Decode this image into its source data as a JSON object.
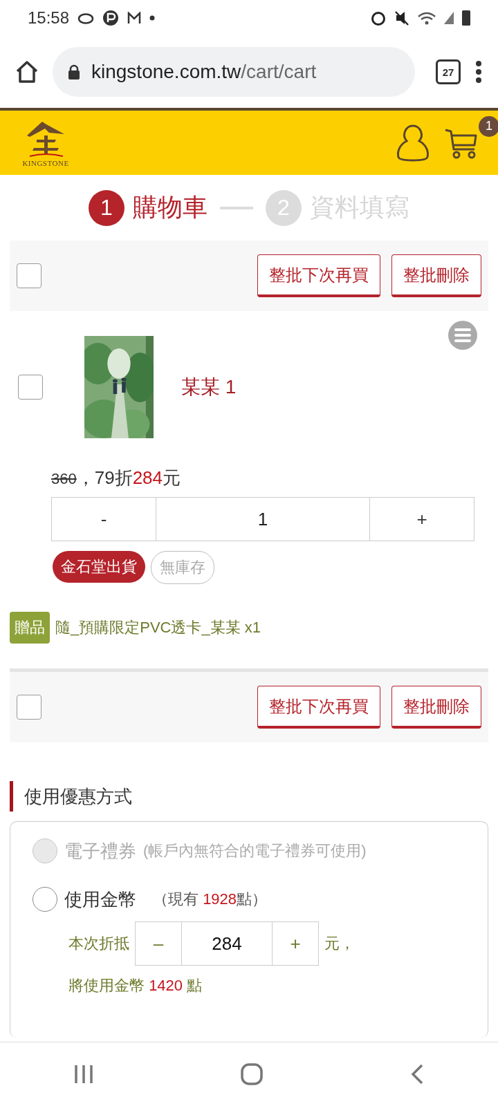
{
  "status_bar": {
    "time": "15:58"
  },
  "browser": {
    "url_host": "kingstone.com.tw",
    "url_path": "/cart/cart",
    "tab_count": "27"
  },
  "header": {
    "logo_text": "KINGSTONE",
    "cart_count": "1"
  },
  "steps": [
    {
      "number": "1",
      "label": "購物車",
      "selected": true
    },
    {
      "number": "2",
      "label": "資料填寫",
      "selected": false
    }
  ],
  "toolbars": [
    {
      "checked": false,
      "buttons": [
        "整批下次再買",
        "整批刪除"
      ]
    },
    {
      "checked": false,
      "buttons": [
        "整批下次再買",
        "整批刪除"
      ]
    }
  ],
  "item": {
    "checked": false,
    "title": "某某 1",
    "list_price": "360",
    "discount": "，79折",
    "price": "284",
    "unit": "元",
    "quantity": "1",
    "minus": "-",
    "plus": "+",
    "tags": [
      {
        "label": "金石堂出貨",
        "kind": "filled"
      },
      {
        "label": "無庫存",
        "kind": "outline"
      }
    ],
    "gift": {
      "badge": "贈品",
      "text": "隨_預購限定PVC透卡_某某 x1"
    }
  },
  "discounts": {
    "title": "使用優惠方式",
    "options": [
      {
        "label": "電子禮券",
        "note": "(帳戶內無符合的電子禮券可使用)",
        "disabled": true,
        "selected": false
      },
      {
        "label": "使用金幣",
        "note_prefix": "（現有 ",
        "points": "1928",
        "note_suffix": "點）",
        "disabled": false,
        "selected": false
      }
    ],
    "coins": {
      "label": "本次折抵",
      "minus": "–",
      "value": "284",
      "plus": "+",
      "unit": "元，",
      "usage_prefix": "將使用金幣 ",
      "usage_points": "1420",
      "usage_suffix": " 點"
    }
  }
}
